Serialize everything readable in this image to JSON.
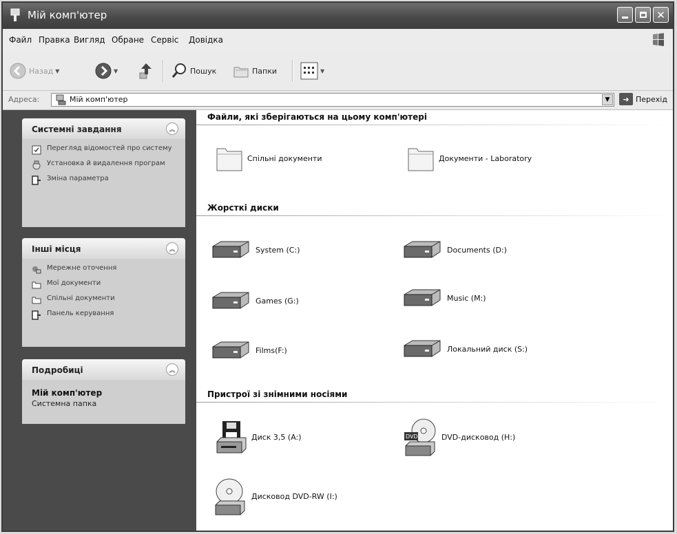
{
  "window": {
    "title": "Мій комп'ютер"
  },
  "menu": [
    "Файл",
    "Правка",
    "Вигляд",
    "Обране",
    "Сервіс",
    "Довідка"
  ],
  "toolbar": {
    "back": "Назад",
    "search": "Пошук",
    "folders": "Папки"
  },
  "address": {
    "label": "Адреса:",
    "value": "Мій комп'ютер",
    "go": "Перехід"
  },
  "sidebar": {
    "system_tasks": {
      "title": "Системні завдання",
      "items": [
        {
          "label": "Перегляд відомостей про систему",
          "icon": "info-icon"
        },
        {
          "label": "Установка й видалення програм",
          "icon": "install-remove-icon"
        },
        {
          "label": "Зміна параметра",
          "icon": "control-panel-icon"
        }
      ]
    },
    "other_places": {
      "title": "Інші місця",
      "items": [
        {
          "label": "Мережне оточення",
          "icon": "network-icon"
        },
        {
          "label": "Мої документи",
          "icon": "folder-icon"
        },
        {
          "label": "Спільні документи",
          "icon": "folder-icon"
        },
        {
          "label": "Панель керування",
          "icon": "control-panel-icon"
        }
      ]
    },
    "details": {
      "title": "Подробиці",
      "name": "Мій комп'ютер",
      "type": "Системна папка"
    }
  },
  "content": {
    "stored_files": {
      "title": "Файли, які зберігаються на цьому комп'ютері",
      "items": [
        {
          "label": "Спільні документи",
          "icon": "folder-icon"
        },
        {
          "label": "Документи - Laboratory",
          "icon": "folder-icon"
        }
      ]
    },
    "hard_drives": {
      "title": "Жорсткі диски",
      "items": [
        {
          "label": "System (C:)",
          "icon": "hard-drive-icon"
        },
        {
          "label": "Documents (D:)",
          "icon": "hard-drive-icon"
        },
        {
          "label": "Games (G:)",
          "icon": "hard-drive-icon"
        },
        {
          "label": "Music (M:)",
          "icon": "hard-drive-icon"
        },
        {
          "label": "Films(F:)",
          "icon": "hard-drive-icon"
        },
        {
          "label": "Локальний диск (S:)",
          "icon": "hard-drive-icon"
        }
      ]
    },
    "removable": {
      "title": "Пристрої зі знімними носіями",
      "items": [
        {
          "label": "Диск 3,5 (A:)",
          "icon": "floppy-drive-icon"
        },
        {
          "label": "DVD-дисковод (H:)",
          "icon": "dvd-drive-icon"
        },
        {
          "label": "Дисковод DVD-RW (I:)",
          "icon": "cd-drive-icon"
        }
      ]
    }
  }
}
